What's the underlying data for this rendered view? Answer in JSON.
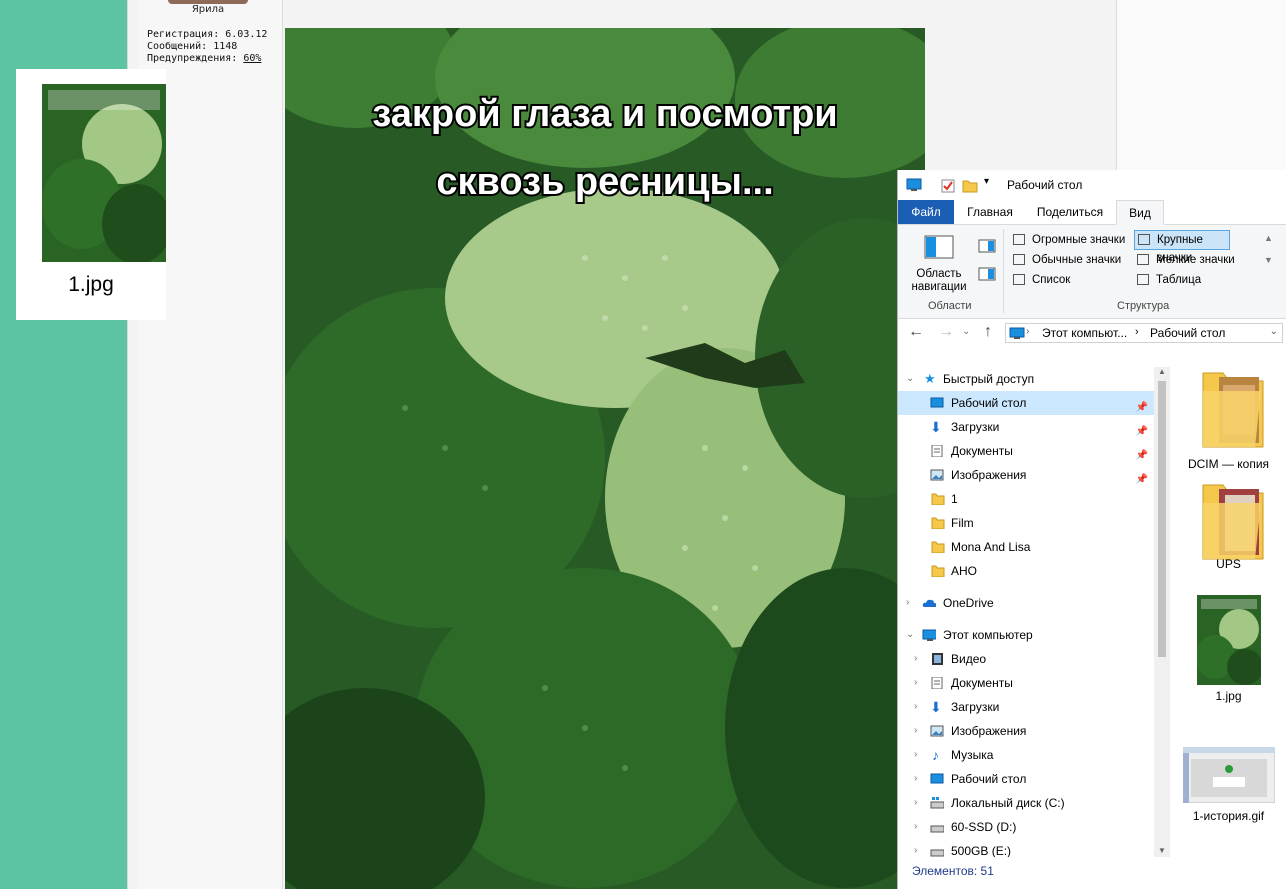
{
  "forum": {
    "username": "Ярила",
    "registration": "Регистрация: 6.03.12",
    "messages": "Сообщений: 1148",
    "warnings_label": "Предупреждения: ",
    "warnings_value": "60%"
  },
  "dragged_file": {
    "name": "1.jpg"
  },
  "post_image": {
    "caption_line1": "закрой глаза и посмотри",
    "caption_line2": "сквозь ресницы..."
  },
  "explorer": {
    "window_title": "Рабочий стол",
    "tabs": [
      "Файл",
      "Главная",
      "Поделиться",
      "Вид"
    ],
    "active_tab": "Вид",
    "ribbon": {
      "nav_pane_label_1": "Область",
      "nav_pane_label_2": "навигации",
      "group_panes": "Области",
      "group_layout": "Структура",
      "layouts": [
        "Огромные значки",
        "Крупные значки",
        "Обычные значки",
        "Мелкие значки",
        "Список",
        "Таблица"
      ],
      "selected_layout": "Крупные значки"
    },
    "address": {
      "part1": "Этот компьют...",
      "separator": "›",
      "part2": "Рабочий стол"
    },
    "nav": {
      "quick_access": "Быстрый доступ",
      "quick_items": [
        "Рабочий стол",
        "Загрузки",
        "Документы",
        "Изображения",
        "1",
        "Film",
        "Mona And Lisa",
        "АНО"
      ],
      "onedrive": "OneDrive",
      "this_pc": "Этот компьютер",
      "pc_items": [
        "Видео",
        "Документы",
        "Загрузки",
        "Изображения",
        "Музыка",
        "Рабочий стол",
        "Локальный диск (C:)",
        "60-SSD (D:)",
        "500GB (E:)"
      ]
    },
    "files": [
      "DCIM — копия",
      "UPS",
      "1.jpg",
      "1-история.gif"
    ],
    "status": "Элементов: 51"
  },
  "colors": {
    "desktop_green": "#5cc4a3",
    "ribbon_file_tab": "#1a5fb4",
    "selection": "#cce8ff",
    "folder_yellow": "#f5c74a"
  }
}
